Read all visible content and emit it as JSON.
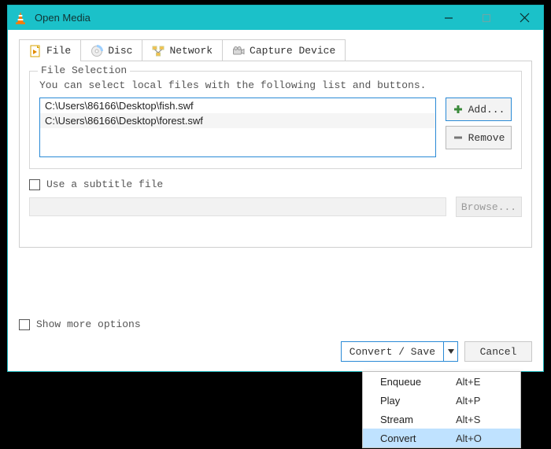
{
  "title": "Open Media",
  "tabs": {
    "file": "File",
    "disc": "Disc",
    "network": "Network",
    "capture": "Capture Device"
  },
  "fileSelection": {
    "legend": "File Selection",
    "help": "You can select local files with the following list and buttons.",
    "files": {
      "f0": "C:\\Users\\86166\\Desktop\\fish.swf",
      "f1": "C:\\Users\\86166\\Desktop\\forest.swf"
    },
    "addBtn": "Add...",
    "removeBtn": "Remove"
  },
  "subtitle": {
    "label": "Use a subtitle file",
    "browse": "Browse..."
  },
  "moreOptions": "Show more options",
  "actions": {
    "convertSave": "Convert / Save",
    "cancel": "Cancel"
  },
  "menu": {
    "enqueue": {
      "label": "Enqueue",
      "accel": "Alt+E"
    },
    "play": {
      "label": "Play",
      "accel": "Alt+P"
    },
    "stream": {
      "label": "Stream",
      "accel": "Alt+S"
    },
    "convert": {
      "label": "Convert",
      "accel": "Alt+O"
    }
  }
}
